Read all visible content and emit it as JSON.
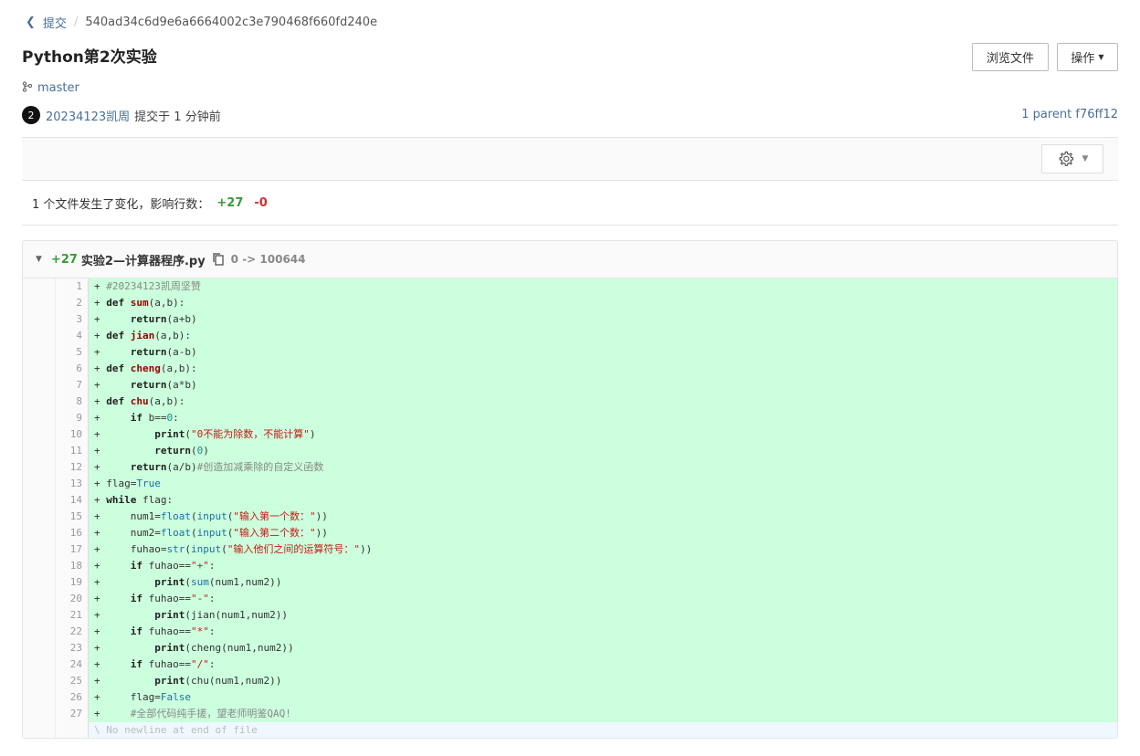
{
  "breadcrumb": {
    "parent": "提交",
    "separator": "/",
    "hash": "540ad34c6d9e6a6664002c3e790468f660fd240e"
  },
  "title": "Python第2次实验",
  "buttons": {
    "browse": "浏览文件",
    "operations": "操作"
  },
  "branch": "master",
  "author": {
    "avatar_text": "2",
    "name": "20234123凯周",
    "committed": "提交于 1 分钟前"
  },
  "parent": "1 parent f76ff12",
  "summary": {
    "text": "1 个文件发生了变化，影响行数：",
    "added": "+27",
    "removed": "-0"
  },
  "file": {
    "added": "+27",
    "name": "实验2—计算器程序.py",
    "mode": "0 -> 100644"
  },
  "code_lines": [
    "+ #20234123凯周坚赞",
    "+ def sum(a,b):",
    "+     return(a+b)",
    "+ def jian(a,b):",
    "+     return(a-b)",
    "+ def cheng(a,b):",
    "+     return(a*b)",
    "+ def chu(a,b):",
    "+     if b==0:",
    "+         print(\"0不能为除数，不能计算\")",
    "+         return(0)",
    "+     return(a/b)#创造加减乘除的自定义函数",
    "+ flag=True",
    "+ while flag:",
    "+     num1=float(input(\"输入第一个数：\"))",
    "+     num2=float(input(\"输入第二个数：\"))",
    "+     fuhao=str(input(\"输入他们之间的运算符号：\"))",
    "+     if fuhao==\"+\":",
    "+         print(sum(num1,num2))",
    "+     if fuhao==\"-\":",
    "+         print(jian(num1,num2))",
    "+     if fuhao==\"*\":",
    "+         print(cheng(num1,num2))",
    "+     if fuhao==\"/\":",
    "+         print(chu(num1,num2))",
    "+     flag=False",
    "+     #全部代码纯手搓，望老师明鉴QAQ!"
  ],
  "no_newline": "\\ No newline at end of file"
}
